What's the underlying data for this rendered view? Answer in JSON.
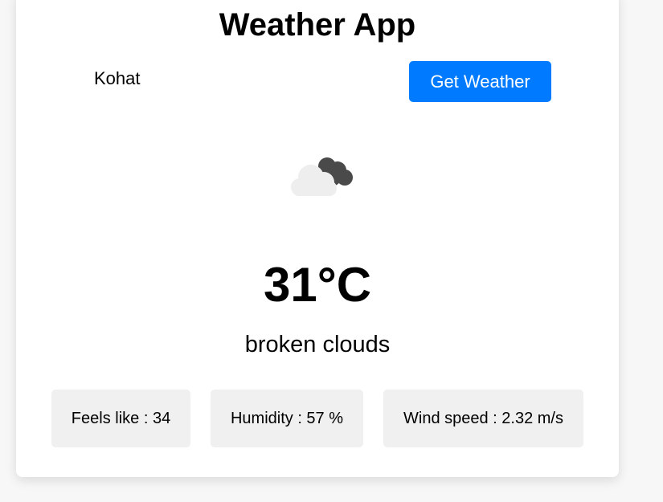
{
  "app": {
    "title": "Weather App"
  },
  "search": {
    "value": "Kohat",
    "button_label": "Get Weather"
  },
  "weather": {
    "icon": "broken-clouds-icon",
    "temperature": "31°C",
    "description": "broken clouds"
  },
  "stats": {
    "feels_like": "Feels like : 34",
    "humidity": "Humidity : 57 %",
    "wind_speed": "Wind speed : 2.32 m/s"
  },
  "colors": {
    "button": "#007bff",
    "stat_background": "#f0f0f0"
  }
}
